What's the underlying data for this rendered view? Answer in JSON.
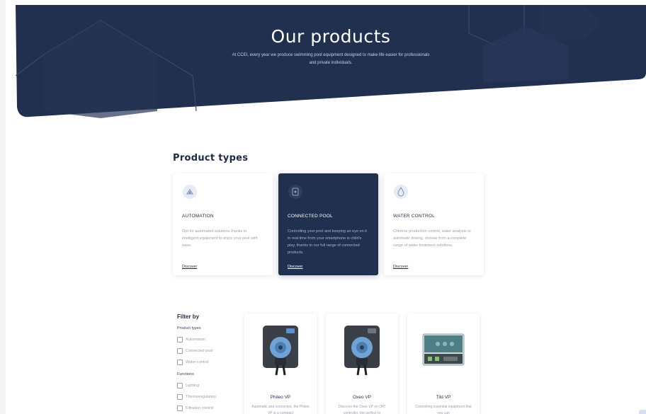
{
  "hero": {
    "title": "Our products",
    "subtitle": "At CCEI, every year we produce swimming pool equipment designed to make life easier for professionals and private individuals."
  },
  "product_types": {
    "title": "Product types",
    "cards": [
      {
        "name": "AUTOMATION",
        "description": "Opt for automated solutions thanks to intelligent equipment to enjoy your pool with ease.",
        "link": "Discover",
        "icon": "automation-icon"
      },
      {
        "name": "CONNECTED POOL",
        "description": "Controlling your pool and keeping an eye on it in real time from your smartphone is child's play, thanks to our full range of connected products.",
        "link": "Discover",
        "icon": "connected-pool-icon"
      },
      {
        "name": "WATER CONTROL",
        "description": "Chlorine production control, water analysis or automatic dosing, choose from a complete range of water treatment solutions.",
        "link": "Discover",
        "icon": "water-control-icon"
      }
    ]
  },
  "filter": {
    "title": "Filter by",
    "groups": [
      {
        "label": "Product types",
        "options": [
          "Automation",
          "Connected pool",
          "Water control"
        ]
      },
      {
        "label": "Functions",
        "options": [
          "Lighting",
          "Thermoregulation",
          "Filtration control"
        ]
      }
    ]
  },
  "products": [
    {
      "name": "Phileo VP",
      "description": "Automatic and connected, the Phileo VP is a compact"
    },
    {
      "name": "Oxeo VP",
      "description": "Discover the Oxeo VP on OR! controller, the perfect to"
    },
    {
      "name": "Tild VP",
      "description": "Controlling essential equipment that you can"
    }
  ],
  "colors": {
    "navy": "#22304f",
    "text": "#1f2a44",
    "muted": "#9aa1ad"
  }
}
